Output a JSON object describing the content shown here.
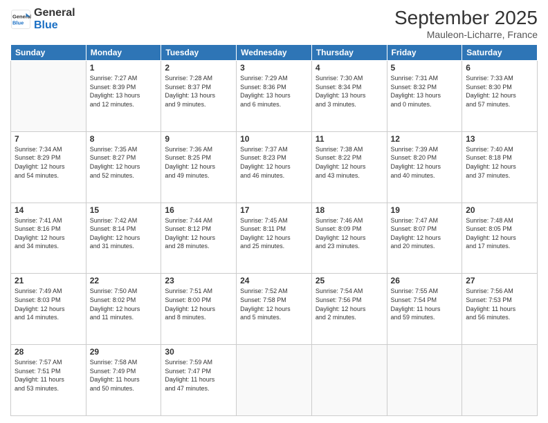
{
  "header": {
    "logo_line1": "General",
    "logo_line2": "Blue",
    "month": "September 2025",
    "location": "Mauleon-Licharre, France"
  },
  "days_of_week": [
    "Sunday",
    "Monday",
    "Tuesday",
    "Wednesday",
    "Thursday",
    "Friday",
    "Saturday"
  ],
  "weeks": [
    [
      {
        "day": "",
        "info": ""
      },
      {
        "day": "1",
        "info": "Sunrise: 7:27 AM\nSunset: 8:39 PM\nDaylight: 13 hours\nand 12 minutes."
      },
      {
        "day": "2",
        "info": "Sunrise: 7:28 AM\nSunset: 8:37 PM\nDaylight: 13 hours\nand 9 minutes."
      },
      {
        "day": "3",
        "info": "Sunrise: 7:29 AM\nSunset: 8:36 PM\nDaylight: 13 hours\nand 6 minutes."
      },
      {
        "day": "4",
        "info": "Sunrise: 7:30 AM\nSunset: 8:34 PM\nDaylight: 13 hours\nand 3 minutes."
      },
      {
        "day": "5",
        "info": "Sunrise: 7:31 AM\nSunset: 8:32 PM\nDaylight: 13 hours\nand 0 minutes."
      },
      {
        "day": "6",
        "info": "Sunrise: 7:33 AM\nSunset: 8:30 PM\nDaylight: 12 hours\nand 57 minutes."
      }
    ],
    [
      {
        "day": "7",
        "info": "Sunrise: 7:34 AM\nSunset: 8:29 PM\nDaylight: 12 hours\nand 54 minutes."
      },
      {
        "day": "8",
        "info": "Sunrise: 7:35 AM\nSunset: 8:27 PM\nDaylight: 12 hours\nand 52 minutes."
      },
      {
        "day": "9",
        "info": "Sunrise: 7:36 AM\nSunset: 8:25 PM\nDaylight: 12 hours\nand 49 minutes."
      },
      {
        "day": "10",
        "info": "Sunrise: 7:37 AM\nSunset: 8:23 PM\nDaylight: 12 hours\nand 46 minutes."
      },
      {
        "day": "11",
        "info": "Sunrise: 7:38 AM\nSunset: 8:22 PM\nDaylight: 12 hours\nand 43 minutes."
      },
      {
        "day": "12",
        "info": "Sunrise: 7:39 AM\nSunset: 8:20 PM\nDaylight: 12 hours\nand 40 minutes."
      },
      {
        "day": "13",
        "info": "Sunrise: 7:40 AM\nSunset: 8:18 PM\nDaylight: 12 hours\nand 37 minutes."
      }
    ],
    [
      {
        "day": "14",
        "info": "Sunrise: 7:41 AM\nSunset: 8:16 PM\nDaylight: 12 hours\nand 34 minutes."
      },
      {
        "day": "15",
        "info": "Sunrise: 7:42 AM\nSunset: 8:14 PM\nDaylight: 12 hours\nand 31 minutes."
      },
      {
        "day": "16",
        "info": "Sunrise: 7:44 AM\nSunset: 8:12 PM\nDaylight: 12 hours\nand 28 minutes."
      },
      {
        "day": "17",
        "info": "Sunrise: 7:45 AM\nSunset: 8:11 PM\nDaylight: 12 hours\nand 25 minutes."
      },
      {
        "day": "18",
        "info": "Sunrise: 7:46 AM\nSunset: 8:09 PM\nDaylight: 12 hours\nand 23 minutes."
      },
      {
        "day": "19",
        "info": "Sunrise: 7:47 AM\nSunset: 8:07 PM\nDaylight: 12 hours\nand 20 minutes."
      },
      {
        "day": "20",
        "info": "Sunrise: 7:48 AM\nSunset: 8:05 PM\nDaylight: 12 hours\nand 17 minutes."
      }
    ],
    [
      {
        "day": "21",
        "info": "Sunrise: 7:49 AM\nSunset: 8:03 PM\nDaylight: 12 hours\nand 14 minutes."
      },
      {
        "day": "22",
        "info": "Sunrise: 7:50 AM\nSunset: 8:02 PM\nDaylight: 12 hours\nand 11 minutes."
      },
      {
        "day": "23",
        "info": "Sunrise: 7:51 AM\nSunset: 8:00 PM\nDaylight: 12 hours\nand 8 minutes."
      },
      {
        "day": "24",
        "info": "Sunrise: 7:52 AM\nSunset: 7:58 PM\nDaylight: 12 hours\nand 5 minutes."
      },
      {
        "day": "25",
        "info": "Sunrise: 7:54 AM\nSunset: 7:56 PM\nDaylight: 12 hours\nand 2 minutes."
      },
      {
        "day": "26",
        "info": "Sunrise: 7:55 AM\nSunset: 7:54 PM\nDaylight: 11 hours\nand 59 minutes."
      },
      {
        "day": "27",
        "info": "Sunrise: 7:56 AM\nSunset: 7:53 PM\nDaylight: 11 hours\nand 56 minutes."
      }
    ],
    [
      {
        "day": "28",
        "info": "Sunrise: 7:57 AM\nSunset: 7:51 PM\nDaylight: 11 hours\nand 53 minutes."
      },
      {
        "day": "29",
        "info": "Sunrise: 7:58 AM\nSunset: 7:49 PM\nDaylight: 11 hours\nand 50 minutes."
      },
      {
        "day": "30",
        "info": "Sunrise: 7:59 AM\nSunset: 7:47 PM\nDaylight: 11 hours\nand 47 minutes."
      },
      {
        "day": "",
        "info": ""
      },
      {
        "day": "",
        "info": ""
      },
      {
        "day": "",
        "info": ""
      },
      {
        "day": "",
        "info": ""
      }
    ]
  ]
}
